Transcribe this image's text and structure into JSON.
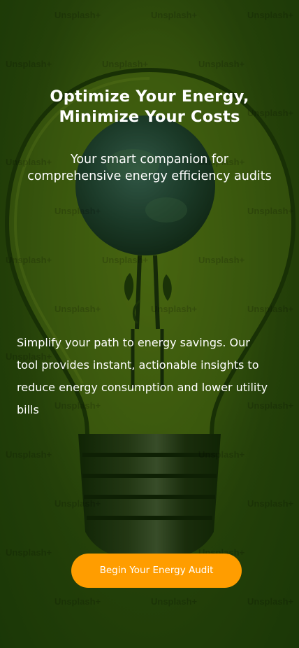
{
  "hero": {
    "headline": {
      "line1": "Optimize Your Energy,",
      "line2": "Minimize Your Costs"
    },
    "subheadline": {
      "line1": "Your smart companion for",
      "line2": "comprehensive energy efficiency audits"
    },
    "description": {
      "line1": "Simplify your path to energy savings. Our",
      "line2": "tool provides instant, actionable insights to",
      "line3": "reduce energy consumption and lower utility",
      "line4": "bills"
    },
    "cta_label": "Begin Your Energy Audit"
  },
  "background": {
    "image_subject": "lightbulb-with-earth-and-sprout",
    "watermark_text": "Unsplash+"
  },
  "colors": {
    "accent": "#ff9d00",
    "overlay": "#163406",
    "text": "#ffffff"
  }
}
